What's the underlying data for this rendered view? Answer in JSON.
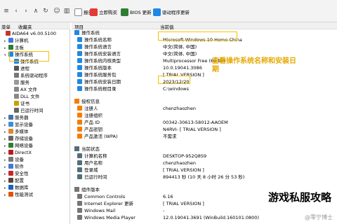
{
  "toolbar": {
    "report": "报告",
    "buy_now": "立即购买",
    "bios_update": "BIOS 更新",
    "driver_update": "驱动程序更新"
  },
  "left_panel": {
    "header_menu": "菜单",
    "header_fav": "收藏夹",
    "items": [
      {
        "label": "AIDA64 v6.00.5100",
        "color": "#c0392b"
      },
      {
        "label": "计算机",
        "color": "#3d7bd9"
      },
      {
        "label": "主板",
        "color": "#2e7d32"
      },
      {
        "label": "操作系统",
        "color": "#1e88e5"
      },
      {
        "label": "操作系统",
        "color": "#1e88e5"
      },
      {
        "label": "进程",
        "color": "#555"
      },
      {
        "label": "系统驱动程序",
        "color": "#777"
      },
      {
        "label": "服务",
        "color": "#999"
      },
      {
        "label": "AX 文件",
        "color": "#888"
      },
      {
        "label": "DLL 文件",
        "color": "#888"
      },
      {
        "label": "证书",
        "color": "#caa000"
      },
      {
        "label": "已运行时间",
        "color": "#666"
      },
      {
        "label": "服务器",
        "color": "#4a6ea9"
      },
      {
        "label": "显示设备",
        "color": "#3a8fd9"
      },
      {
        "label": "多媒体",
        "color": "#d98a2b"
      },
      {
        "label": "存储设备",
        "color": "#666"
      },
      {
        "label": "网络设备",
        "color": "#2e7d32"
      },
      {
        "label": "DirectX",
        "color": "#b71c1c"
      },
      {
        "label": "设备",
        "color": "#777"
      },
      {
        "label": "软件",
        "color": "#3d7bd9"
      },
      {
        "label": "安全性",
        "color": "#c62828"
      },
      {
        "label": "配置",
        "color": "#5d4037"
      },
      {
        "label": "数据库",
        "color": "#1565c0"
      },
      {
        "label": "性能测试",
        "color": "#e65100"
      }
    ]
  },
  "right_panel": {
    "header_item": "项目",
    "header_value": "当前值",
    "sections": {
      "os": "操作系统",
      "license": "授权信息",
      "current": "当前状态",
      "components": "组件版本"
    },
    "os_rows": [
      {
        "label": "操作系统名称",
        "value": "Microsoft Windows 10 Home China"
      },
      {
        "label": "操作系统语言",
        "value": "中文(简体, 中国)"
      },
      {
        "label": "操作系统安装语言",
        "value": "中文(简体, 中国)"
      },
      {
        "label": "操作系统内核类型",
        "value": "Multiprocessor Free (64-bit)"
      },
      {
        "label": "操作系统版本",
        "value": "10.0.19041.3086"
      },
      {
        "label": "操作系统服务包",
        "value": "[ TRIAL VERSION ]"
      },
      {
        "label": "操作系统安装日期",
        "value": "2023/12/20"
      },
      {
        "label": "操作系统根目录",
        "value": "C:\\windows"
      }
    ],
    "license_rows": [
      {
        "label": "注册人",
        "value": "chenzhaozhen"
      },
      {
        "label": "注册组织",
        "value": ""
      },
      {
        "label": "产品 ID",
        "value": "00342-30613-58012-AAOEM"
      },
      {
        "label": "产品密钥",
        "value": "N4RVI- [ TRIAL VERSION ]"
      },
      {
        "label": "产品激活 (WPA)",
        "value": "不需求"
      }
    ],
    "current_rows": [
      {
        "label": "计算机名称",
        "value": "DESKTOP-952Q8S9"
      },
      {
        "label": "用户名称",
        "value": "chenzhaozhen"
      },
      {
        "label": "登录域",
        "value": "[ TRIAL VERSION ]"
      },
      {
        "label": "已运行时间",
        "value": "894413 秒 (10 天 8 小时 26 分 53 秒)"
      }
    ],
    "component_rows": [
      {
        "label": "Common Controls",
        "value": "6.16"
      },
      {
        "label": "Internet Explorer 更新",
        "value": "[ TRIAL VERSION ]"
      },
      {
        "label": "Windows Mail",
        "value": "-"
      },
      {
        "label": "Windows Media Player",
        "value": "12.0.19041.3691 (WinBuild.160101.0800)"
      }
    ]
  },
  "annotation": {
    "line1": "查看操作系统名称和安装日",
    "line2": "期"
  },
  "watermark": {
    "title": "游戏私服攻略",
    "small": "@零宁博士"
  }
}
